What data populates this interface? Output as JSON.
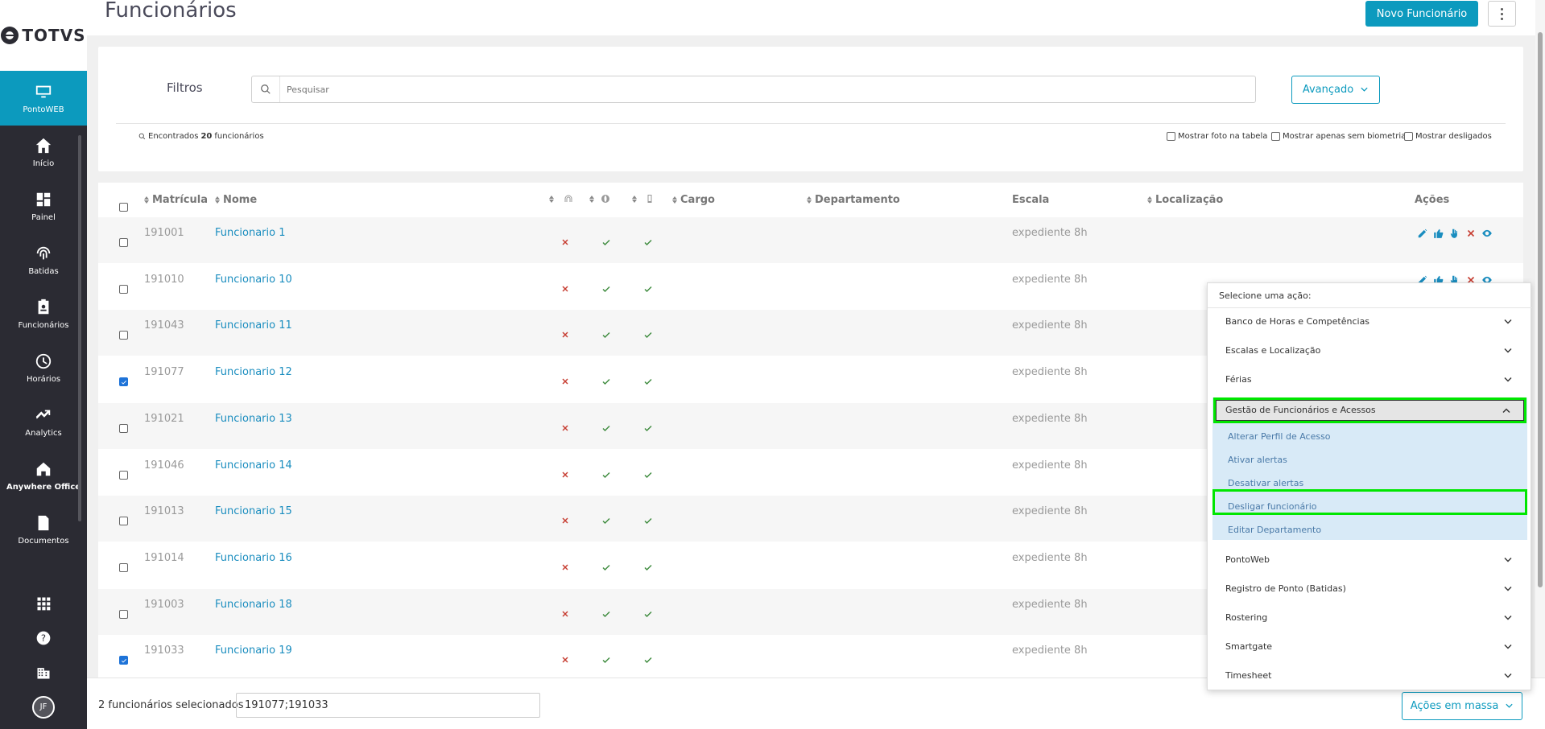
{
  "brand": {
    "logo_text": "TOTVS"
  },
  "sidebar": {
    "items": [
      {
        "label": "PontoWEB",
        "icon": "monitor-icon",
        "active": true
      },
      {
        "label": "Início",
        "icon": "home-icon"
      },
      {
        "label": "Painel",
        "icon": "dashboard-icon"
      },
      {
        "label": "Batidas",
        "icon": "fingerprint-icon"
      },
      {
        "label": "Funcionários",
        "icon": "badge-icon"
      },
      {
        "label": "Horários",
        "icon": "clock-icon"
      },
      {
        "label": "Analytics",
        "icon": "trend-icon"
      },
      {
        "label": "Anywhere Office",
        "icon": "house-icon"
      },
      {
        "label": "Documentos",
        "icon": "document-icon"
      }
    ],
    "bottom": {
      "avatar_initials": "JF"
    }
  },
  "header": {
    "title": "Funcionários",
    "new_button": "Novo Funcionário"
  },
  "filters": {
    "label": "Filtros",
    "search_placeholder": "Pesquisar",
    "advanced_label": "Avançado",
    "found_prefix": "Encontrados",
    "found_count": "20",
    "found_suffix": "funcionários",
    "options": [
      "Mostrar foto na tabela",
      "Mostrar apenas sem biometria",
      "Mostrar desligados"
    ]
  },
  "table": {
    "headers": {
      "matricula": "Matrícula",
      "nome": "Nome",
      "cargo": "Cargo",
      "departamento": "Departamento",
      "escala": "Escala",
      "localizacao": "Localização",
      "acoes": "Ações"
    },
    "rows": [
      {
        "matricula": "191001",
        "nome": "Funcionario 1",
        "escala": "expediente 8h",
        "checked": false
      },
      {
        "matricula": "191010",
        "nome": "Funcionario 10",
        "escala": "expediente 8h",
        "checked": false
      },
      {
        "matricula": "191043",
        "nome": "Funcionario 11",
        "escala": "expediente 8h",
        "checked": false
      },
      {
        "matricula": "191077",
        "nome": "Funcionario 12",
        "escala": "expediente 8h",
        "checked": true
      },
      {
        "matricula": "191021",
        "nome": "Funcionario 13",
        "escala": "expediente 8h",
        "checked": false
      },
      {
        "matricula": "191046",
        "nome": "Funcionario 14",
        "escala": "expediente 8h",
        "checked": false
      },
      {
        "matricula": "191013",
        "nome": "Funcionario 15",
        "escala": "expediente 8h",
        "checked": false
      },
      {
        "matricula": "191014",
        "nome": "Funcionario 16",
        "escala": "expediente 8h",
        "checked": false
      },
      {
        "matricula": "191003",
        "nome": "Funcionario 18",
        "escala": "expediente 8h",
        "checked": false
      },
      {
        "matricula": "191033",
        "nome": "Funcionario 19",
        "escala": "expediente 8h",
        "checked": true
      }
    ]
  },
  "footer": {
    "selected_label": "2 funcionários selecionados",
    "selected_value": "191077;191033",
    "mass_actions": "Ações em massa"
  },
  "dropdown": {
    "heading": "Selecione uma ação:",
    "groups_before": [
      "Banco de Horas e Competências",
      "Escalas e Localização",
      "Férias"
    ],
    "open_group": "Gestão de Funcionários e Acessos",
    "sub_items": [
      "Alterar Perfil de Acesso",
      "Ativar alertas",
      "Desativar alertas",
      "Desligar funcionário",
      "Editar Departamento"
    ],
    "groups_after": [
      "PontoWeb",
      "Registro de Ponto (Batidas)",
      "Rostering",
      "Smartgate",
      "Timesheet"
    ]
  },
  "colors": {
    "accent": "#0c9abe",
    "sidebar": "#2b2b33",
    "highlight": "#00e600",
    "error": "#c63b2f",
    "success": "#3c8a3c"
  }
}
